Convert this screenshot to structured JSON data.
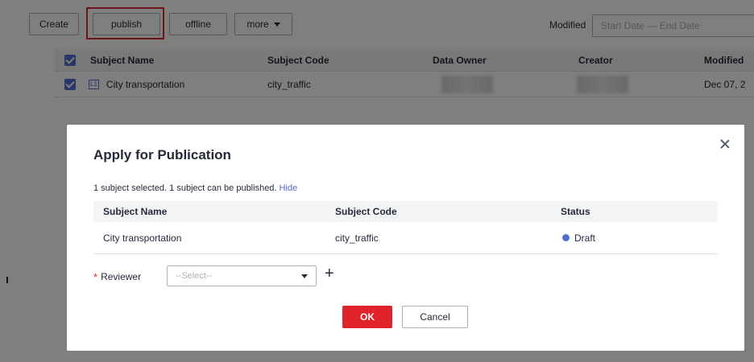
{
  "toolbar": {
    "create_label": "Create",
    "publish_label": "publish",
    "offline_label": "offline",
    "more_label": "more",
    "modified_label": "Modified",
    "date_placeholder": "Start Date — End Date"
  },
  "list": {
    "columns": [
      "Subject Name",
      "Subject Code",
      "Data Owner",
      "Creator",
      "Modified"
    ],
    "rows": [
      {
        "level": "L1",
        "subject_name": "City transportation",
        "subject_code": "city_traffic",
        "modified": "Dec 07, 2"
      }
    ]
  },
  "dialog": {
    "title": "Apply for Publication",
    "summary": "1 subject selected. 1 subject can be published.",
    "hide_link": "Hide",
    "columns": [
      "Subject Name",
      "Subject Code",
      "Status"
    ],
    "rows": [
      {
        "subject_name": "City transportation",
        "subject_code": "city_traffic",
        "status": "Draft"
      }
    ],
    "reviewer_label": "Reviewer",
    "required_mark": "*",
    "reviewer_placeholder": "--Select--",
    "add_symbol": "+",
    "ok_label": "OK",
    "cancel_label": "Cancel"
  },
  "colors": {
    "accent": "#526ecc",
    "danger": "#e0222a",
    "status_draft": "#526ecc"
  }
}
